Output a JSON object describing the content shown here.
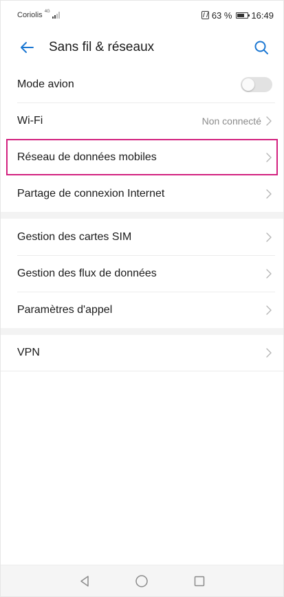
{
  "status_bar": {
    "carrier": "Coriolis",
    "network_type": "4G",
    "battery_percent": "63 %",
    "time": "16:49"
  },
  "header": {
    "title": "Sans fil & réseaux",
    "back_icon": "arrow-left-icon",
    "search_icon": "search-icon"
  },
  "colors": {
    "accent": "#1976d2",
    "highlight_border": "#d21f7e"
  },
  "groups": [
    {
      "items": [
        {
          "label": "Mode avion",
          "type": "toggle",
          "enabled": false
        },
        {
          "label": "Wi-Fi",
          "value": "Non connecté",
          "type": "link"
        },
        {
          "label": "Réseau de données mobiles",
          "type": "link",
          "highlighted": true
        },
        {
          "label": "Partage de connexion Internet",
          "type": "link"
        }
      ]
    },
    {
      "items": [
        {
          "label": "Gestion des cartes SIM",
          "type": "link"
        },
        {
          "label": "Gestion des flux de données",
          "type": "link"
        },
        {
          "label": "Paramètres d'appel",
          "type": "link"
        }
      ]
    },
    {
      "items": [
        {
          "label": "VPN",
          "type": "link"
        }
      ]
    }
  ],
  "nav_bar": {
    "back_icon": "triangle-back-icon",
    "home_icon": "circle-home-icon",
    "recents_icon": "square-recents-icon"
  }
}
